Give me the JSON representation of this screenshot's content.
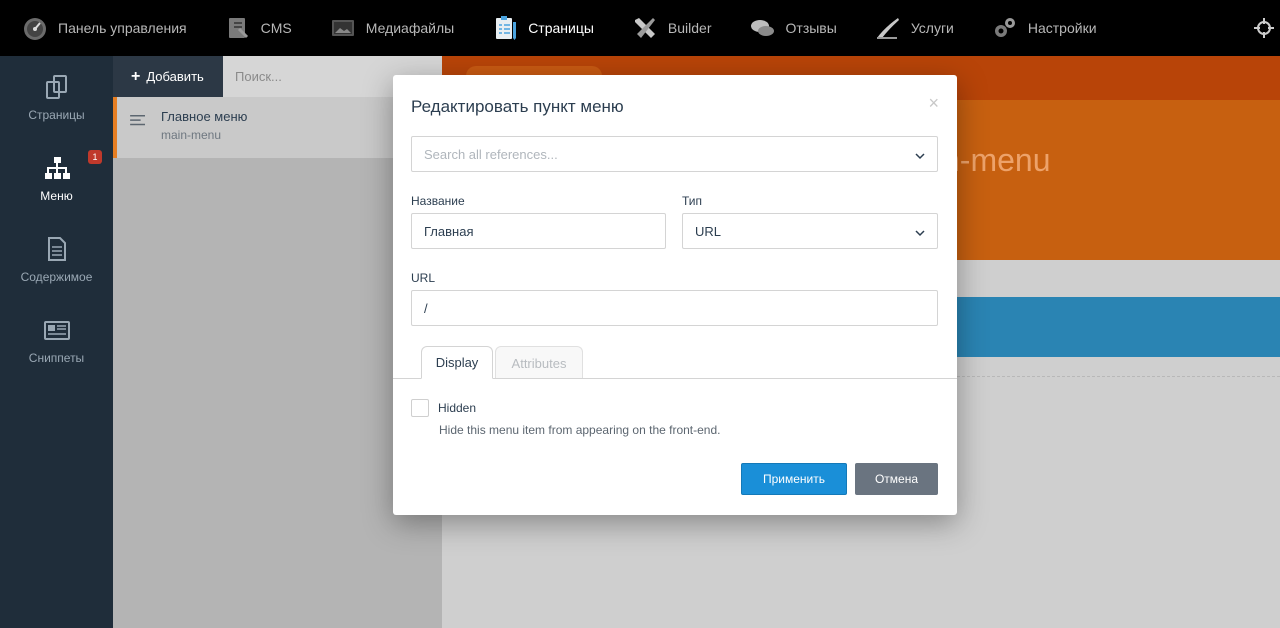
{
  "topbar": {
    "items": [
      {
        "label": "Панель управления",
        "icon": "dashboard-icon"
      },
      {
        "label": "CMS",
        "icon": "cms-icon"
      },
      {
        "label": "Медиафайлы",
        "icon": "media-icon"
      },
      {
        "label": "Страницы",
        "icon": "pages-icon",
        "active": true
      },
      {
        "label": "Builder",
        "icon": "builder-icon"
      },
      {
        "label": "Отзывы",
        "icon": "reviews-icon"
      },
      {
        "label": "Услуги",
        "icon": "services-icon"
      },
      {
        "label": "Настройки",
        "icon": "settings-icon"
      }
    ],
    "right_icon": "move-icon"
  },
  "sidebar": {
    "items": [
      {
        "label": "Страницы",
        "icon": "pages-icon"
      },
      {
        "label": "Меню",
        "icon": "sitemap-icon",
        "active": true,
        "badge": "1"
      },
      {
        "label": "Содержимое",
        "icon": "document-icon"
      },
      {
        "label": "Сниппеты",
        "icon": "snippets-icon"
      }
    ]
  },
  "list": {
    "add_label": "Добавить",
    "search_placeholder": "Поиск...",
    "items": [
      {
        "title": "Главное меню",
        "code": "main-menu"
      }
    ]
  },
  "background": {
    "hero_text": "n-menu"
  },
  "modal": {
    "title": "Редактировать пункт меню",
    "close": "×",
    "reference_placeholder": "Search all references...",
    "name_label": "Название",
    "name_value": "Главная",
    "type_label": "Тип",
    "type_value": "URL",
    "url_label": "URL",
    "url_value": "/",
    "tabs": [
      "Display",
      "Attributes"
    ],
    "hidden_label": "Hidden",
    "hidden_help": "Hide this menu item from appearing on the front-end.",
    "apply_label": "Применить",
    "cancel_label": "Отмена"
  },
  "colors": {
    "accent": "#e67e22",
    "primary_button": "#1a8fd8",
    "sidebar_bg": "#1f2d3a",
    "badge": "#c0392b"
  }
}
